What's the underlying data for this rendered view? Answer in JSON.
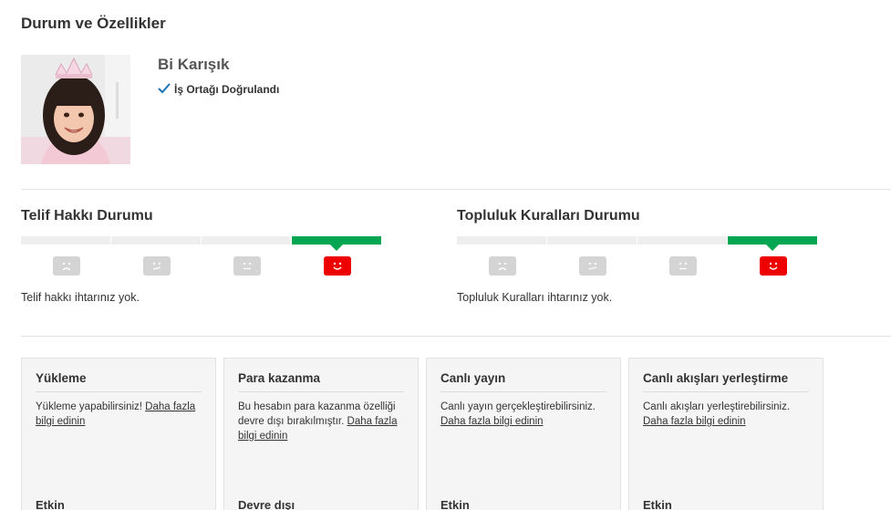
{
  "page": {
    "title": "Durum ve Özellikler"
  },
  "profile": {
    "name": "Bi Karışık",
    "badge_icon": "checkmark-icon",
    "badge_label": "İş Ortağı Doğrulandı"
  },
  "copyright": {
    "title": "Telif Hakkı Durumu",
    "level": 4,
    "faces": [
      "sad-face-icon",
      "meh-face-icon",
      "neutral-face-icon",
      "happy-face-icon"
    ],
    "message": "Telif hakkı ihtarınız yok."
  },
  "community": {
    "title": "Topluluk Kuralları Durumu",
    "level": 4,
    "faces": [
      "sad-face-icon",
      "meh-face-icon",
      "neutral-face-icon",
      "happy-face-icon"
    ],
    "message": "Topluluk Kuralları ihtarınız yok."
  },
  "features": [
    {
      "title": "Yükleme",
      "text": "Yükleme yapabilirsiniz! ",
      "link": "Daha fazla bilgi edinin",
      "state": "Etkin"
    },
    {
      "title": "Para kazanma",
      "text": "Bu hesabın para kazanma özelliği devre dışı bırakılmıştır. ",
      "link": "Daha fazla bilgi edinin",
      "state": "Devre dışı"
    },
    {
      "title": "Canlı yayın",
      "text": "Canlı yayın gerçekleştirebilirsiniz. ",
      "link": "Daha fazla bilgi edinin",
      "state": "Etkin"
    },
    {
      "title": "Canlı akışları yerleştirme",
      "text": "Canlı akışları yerleştirebilirsiniz. ",
      "link": "Daha fazla bilgi edinin",
      "state": "Etkin"
    }
  ],
  "colors": {
    "good": "#00a651",
    "active_face": "#ee0000",
    "inactive_face": "#d4d4d4",
    "link": "#1a73b8"
  }
}
